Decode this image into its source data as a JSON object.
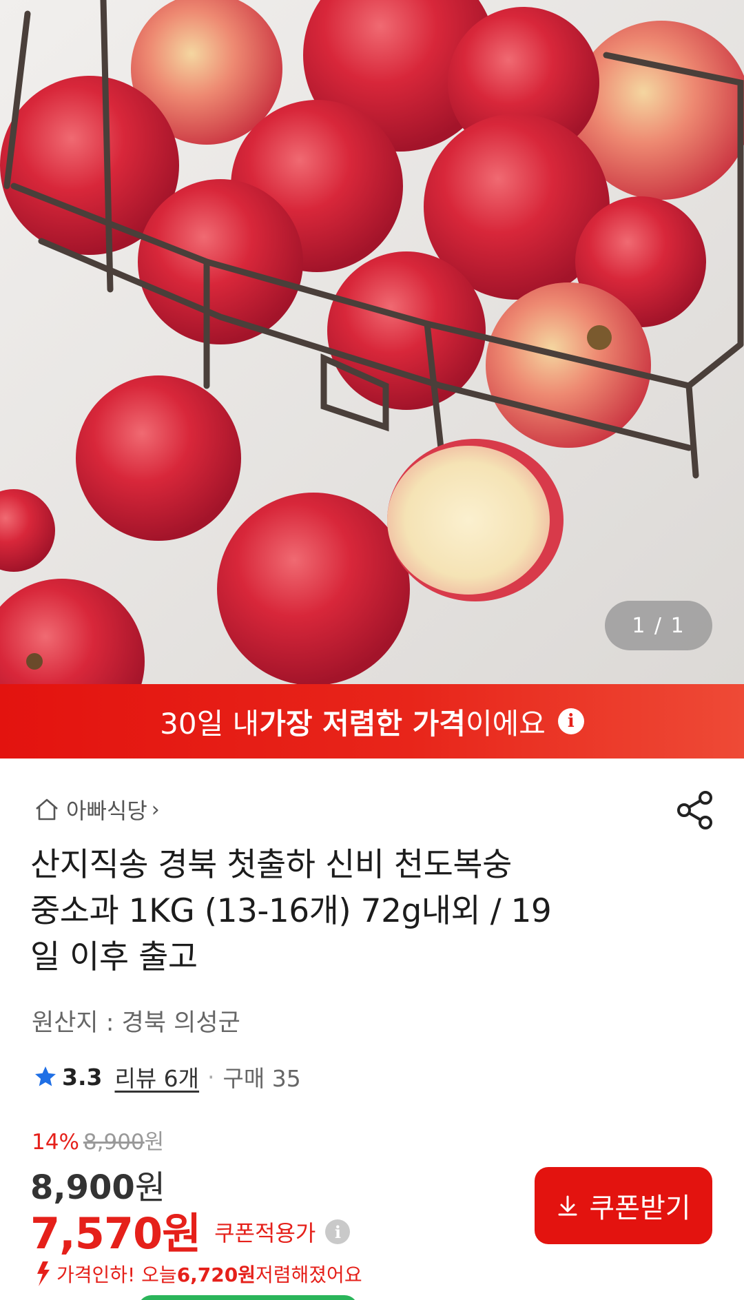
{
  "hero": {
    "page_indicator": "1 / 1"
  },
  "banner": {
    "prefix": "30일 내 ",
    "highlight": "가장 저렴한 가격",
    "suffix": "이에요"
  },
  "store": {
    "name": "아빠식당",
    "chevron": "›"
  },
  "product": {
    "title_line1": "산지직송 경북 첫출하 신비 천도복숭",
    "title_line2": "중소과 1KG (13-16개) 72g내외 / 19",
    "title_line3": "일 이후 출고",
    "origin": "원산지 : 경북 의성군"
  },
  "rating": {
    "score": "3.3",
    "review": "리뷰 6개",
    "separator": "·",
    "purchases": "구매 35"
  },
  "price": {
    "discount_pct": "14%",
    "original": "8,900",
    "original_won": "원",
    "sale": "8,900",
    "sale_won": "원",
    "coupon_price": "7,570",
    "coupon_won": "원",
    "coupon_label": "쿠폰적용가"
  },
  "coupon_button": {
    "label": "쿠폰받기"
  },
  "price_drop": {
    "prefix": "가격인하! 오늘 ",
    "amount": "6,720원",
    "suffix": " 저렴해졌어요"
  },
  "colors": {
    "accent_red": "#e3130f",
    "text_dark": "#1c1c1c",
    "text_muted": "#666666",
    "star_blue": "#1f6fe5"
  }
}
